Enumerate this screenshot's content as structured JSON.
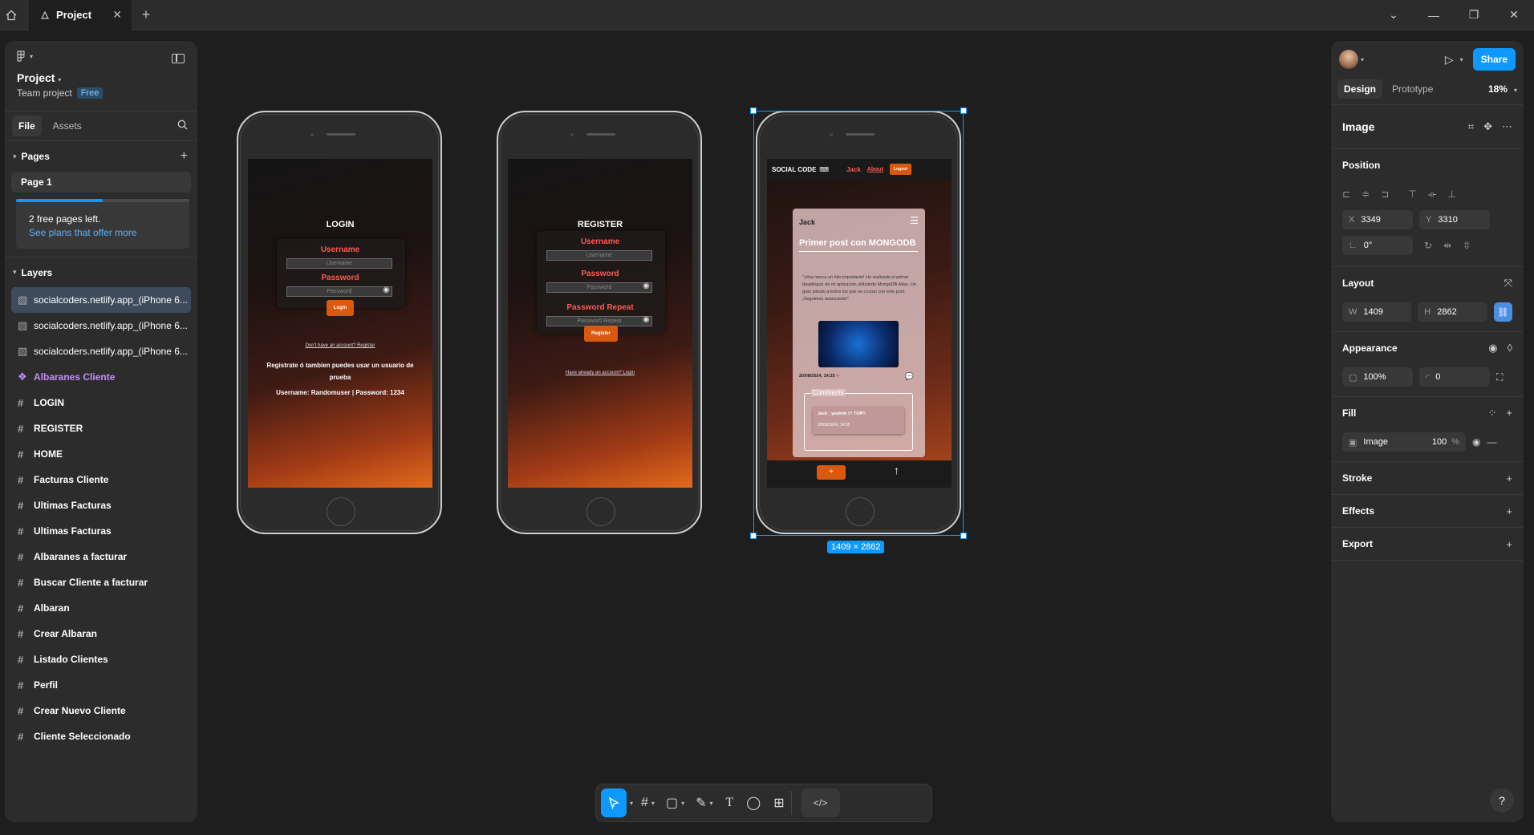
{
  "titlebar": {
    "tab_label": "Project",
    "tab_close": "✕",
    "new_tab": "+",
    "window_controls": [
      "⌄",
      "—",
      "❐",
      "✕"
    ]
  },
  "left": {
    "project_name": "Project",
    "project_sub": "Team project",
    "plan_badge": "Free",
    "tabs": [
      "File",
      "Assets"
    ],
    "pages_heading": "Pages",
    "page_item": "Page 1",
    "free_pages_progress": 0.5,
    "free_pages_text": "2 free pages left.",
    "free_pages_link": "See plans that offer more",
    "layers_heading": "Layers",
    "layers": [
      {
        "label": "socialcoders.netlify.app_(iPhone 6...",
        "icon": "image-icon",
        "selected": true
      },
      {
        "label": "socialcoders.netlify.app_(iPhone 6...",
        "icon": "image-icon"
      },
      {
        "label": "socialcoders.netlify.app_(iPhone 6...",
        "icon": "image-icon"
      },
      {
        "label": "Albaranes Cliente",
        "icon": "component-icon"
      },
      {
        "label": "LOGIN",
        "icon": "frame-icon"
      },
      {
        "label": "REGISTER",
        "icon": "frame-icon"
      },
      {
        "label": "HOME",
        "icon": "frame-icon"
      },
      {
        "label": "Facturas Cliente",
        "icon": "frame-icon"
      },
      {
        "label": "Ultimas Facturas",
        "icon": "frame-icon"
      },
      {
        "label": "Ultimas Facturas",
        "icon": "frame-icon"
      },
      {
        "label": "Albaranes a facturar",
        "icon": "frame-icon"
      },
      {
        "label": "Buscar Cliente a facturar",
        "icon": "frame-icon"
      },
      {
        "label": "Albaran",
        "icon": "frame-icon"
      },
      {
        "label": "Crear Albaran",
        "icon": "frame-icon"
      },
      {
        "label": "Listado Clientes",
        "icon": "frame-icon"
      },
      {
        "label": "Perfil",
        "icon": "frame-icon"
      },
      {
        "label": "Crear Nuevo Cliente",
        "icon": "frame-icon"
      },
      {
        "label": "Cliente Seleccionado",
        "icon": "frame-icon"
      }
    ]
  },
  "canvas": {
    "login": {
      "title": "LOGIN",
      "username_label": "Username",
      "username_placeholder": "Username",
      "password_label": "Password",
      "password_placeholder": "Password",
      "button": "Login",
      "link": "Don't have an account? Register",
      "info1": "Registrate ó tambien puedes usar un usuario de prueba",
      "info2": "Username: Randomuser | Password: 1234"
    },
    "register": {
      "title": "REGISTER",
      "username_label": "Username",
      "username_placeholder": "Username",
      "password_label": "Password",
      "password_placeholder": "Password",
      "repeat_label": "Password Repeat",
      "repeat_placeholder": "Password Repeat",
      "button": "Register",
      "link": "Have already an account? Login"
    },
    "social": {
      "brand": "SOCIAL CODE",
      "nav_user": "Jack",
      "nav_about": "About",
      "nav_logout": "Logout",
      "post_author": "Jack",
      "post_title": "Primer post con MONGODB",
      "post_body": "\"¡Hoy marca un hito importante! He realizado el primer despliegue de mi aplicación utilizando MongoDB Atlas. Un gran saludo a todos los que se cruzan con este post. ¡Seguimos avanzando!\"",
      "post_date": "20/08/2024, 14:25",
      "comments_title": "Comments",
      "comment_text": "Jack : yeahhh !!! TOP!!",
      "comment_date": "20/08/2024, 14:25",
      "add_button": "+",
      "up_arrow": "↑"
    },
    "selection_size": "1409 × 2862"
  },
  "toolbar": {
    "tools": [
      "move",
      "frame",
      "shape",
      "pen",
      "text",
      "comment",
      "actions",
      "dev-mode"
    ]
  },
  "right": {
    "share": "Share",
    "tabs": [
      "Design",
      "Prototype"
    ],
    "zoom": "18%",
    "selection_type": "Image",
    "position_heading": "Position",
    "x": "3349",
    "y": "3310",
    "rotation": "0°",
    "layout_heading": "Layout",
    "w": "1409",
    "h": "2862",
    "appearance_heading": "Appearance",
    "opacity": "100%",
    "radius": "0",
    "fill_heading": "Fill",
    "fill_type": "Image",
    "fill_opacity": "100",
    "fill_pct": "%",
    "stroke_heading": "Stroke",
    "effects_heading": "Effects",
    "export_heading": "Export",
    "help": "?"
  }
}
